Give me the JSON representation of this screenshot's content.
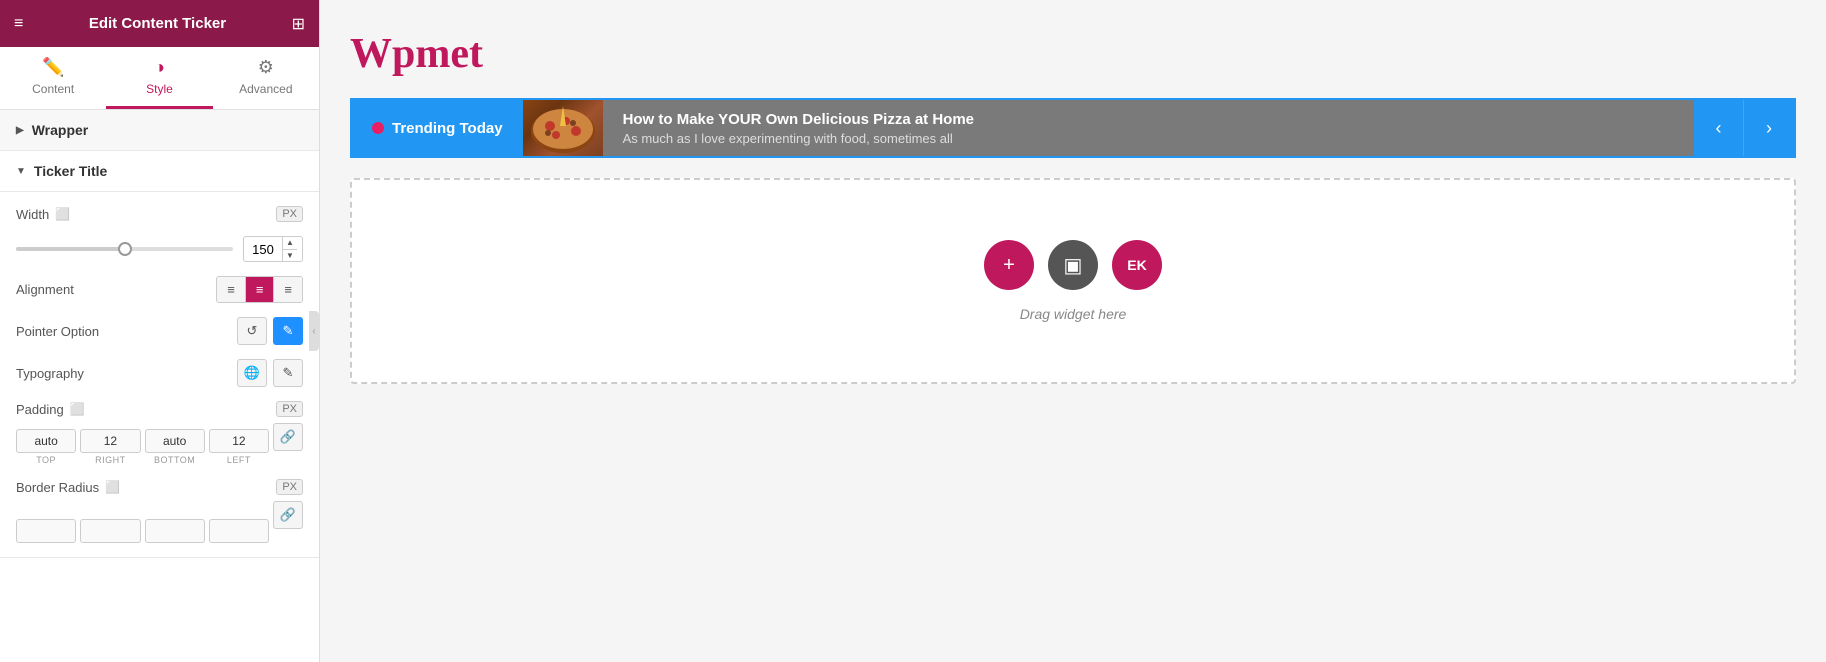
{
  "header": {
    "title": "Edit Content Ticker",
    "menu_icon": "≡",
    "grid_icon": "⊞"
  },
  "tabs": [
    {
      "id": "content",
      "label": "Content",
      "icon": "✏",
      "active": false
    },
    {
      "id": "style",
      "label": "Style",
      "icon": "◑",
      "active": true
    },
    {
      "id": "advanced",
      "label": "Advanced",
      "icon": "⚙",
      "active": false
    }
  ],
  "sections": {
    "wrapper": {
      "label": "Wrapper",
      "collapsed": true
    },
    "ticker_title": {
      "label": "Ticker Title",
      "collapsed": false
    }
  },
  "controls": {
    "width": {
      "label": "Width",
      "unit": "PX",
      "value": 150
    },
    "alignment": {
      "label": "Alignment",
      "options": [
        "left",
        "center",
        "right"
      ],
      "active": "center"
    },
    "pointer_option": {
      "label": "Pointer Option"
    },
    "typography": {
      "label": "Typography"
    },
    "padding": {
      "label": "Padding",
      "unit": "PX",
      "icon": "responsive",
      "top": "auto",
      "right": "12",
      "bottom": "auto",
      "left": "12"
    },
    "border_radius": {
      "label": "Border Radius",
      "unit": "PX"
    }
  },
  "preview": {
    "title": "Wpmet",
    "ticker": {
      "label": "Trending Today",
      "headline": "How to Make YOUR Own Delicious Pizza at Home",
      "subtext": "As much as I love experimenting with food, sometimes all",
      "nav_prev": "‹",
      "nav_next": "›"
    },
    "drop_zone": {
      "text": "Drag widget here",
      "btn_add": "+",
      "btn_folder": "▣",
      "btn_ek": "EK"
    }
  }
}
